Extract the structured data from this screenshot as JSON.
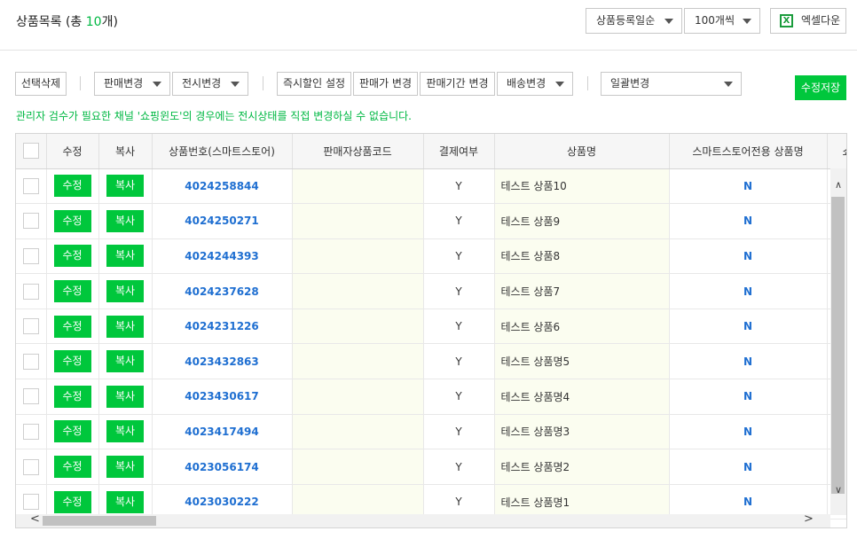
{
  "header": {
    "title_prefix": "상품목록 (총 ",
    "title_count": "10",
    "title_suffix": "개)",
    "sort_select": "상품등록일순",
    "page_size_select": "100개씩",
    "excel_label": "엑셀다운",
    "excel_icon": "excel-icon"
  },
  "toolbar": {
    "delete_selected": "선택삭제",
    "sale_change": "판매변경",
    "display_change": "전시변경",
    "instant_discount": "즉시할인 설정",
    "price_change": "판매가 변경",
    "period_change": "판매기간 변경",
    "delivery_change": "배송변경",
    "bulk_change": "일괄변경",
    "save": "수정저장"
  },
  "notice": "관리자 검수가 필요한 채널 '쇼핑윈도'의 경우에는 전시상태를 직접 변경하실 수 없습니다.",
  "table": {
    "columns": [
      "",
      "수정",
      "복사",
      "상품번호(스마트스토어)",
      "판매자상품코드",
      "결제여부",
      "상품명",
      "스마트스토어전용 상품명",
      "쇼"
    ],
    "edit_label": "수정",
    "copy_label": "복사",
    "rows": [
      {
        "id": "4024258844",
        "code": "",
        "paid": "Y",
        "name": "테스트 상품10",
        "store_only": "N"
      },
      {
        "id": "4024250271",
        "code": "",
        "paid": "Y",
        "name": "테스트 상품9",
        "store_only": "N"
      },
      {
        "id": "4024244393",
        "code": "",
        "paid": "Y",
        "name": "테스트 상품8",
        "store_only": "N"
      },
      {
        "id": "4024237628",
        "code": "",
        "paid": "Y",
        "name": "테스트 상품7",
        "store_only": "N"
      },
      {
        "id": "4024231226",
        "code": "",
        "paid": "Y",
        "name": "테스트 상품6",
        "store_only": "N"
      },
      {
        "id": "4023432863",
        "code": "",
        "paid": "Y",
        "name": "테스트 상품명5",
        "store_only": "N"
      },
      {
        "id": "4023430617",
        "code": "",
        "paid": "Y",
        "name": "테스트 상품명4",
        "store_only": "N"
      },
      {
        "id": "4023417494",
        "code": "",
        "paid": "Y",
        "name": "테스트 상품명3",
        "store_only": "N"
      },
      {
        "id": "4023056174",
        "code": "",
        "paid": "Y",
        "name": "테스트 상품명2",
        "store_only": "N"
      },
      {
        "id": "4023030222",
        "code": "",
        "paid": "Y",
        "name": "테스트 상품명1",
        "store_only": "N"
      }
    ]
  },
  "colors": {
    "accent": "#00c73c",
    "link": "#1f6fd1"
  }
}
